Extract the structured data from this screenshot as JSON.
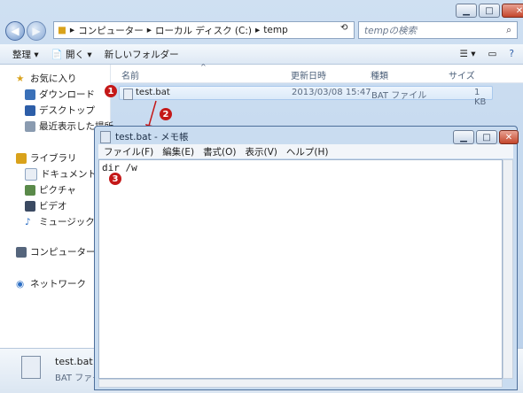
{
  "address": {
    "path": [
      "コンピューター",
      "ローカル ディスク (C:)",
      "temp"
    ]
  },
  "search": {
    "placeholder": "tempの検索"
  },
  "toolbar": {
    "organize": "整理",
    "open": "開く",
    "new_folder": "新しいフォルダー"
  },
  "nav": {
    "favorites": "お気に入り",
    "fav_items": [
      "ダウンロード",
      "デスクトップ",
      "最近表示した場所"
    ],
    "libraries": "ライブラリ",
    "lib_items": [
      "ドキュメント",
      "ピクチャ",
      "ビデオ",
      "ミュージック"
    ],
    "computer": "コンピューター",
    "network": "ネットワーク"
  },
  "columns": {
    "name": "名前",
    "date": "更新日時",
    "type": "種類",
    "size": "サイズ"
  },
  "file": {
    "name": "test.bat",
    "date": "2013/03/08 15:47",
    "type": "BAT ファイル",
    "size": "1 KB"
  },
  "details": {
    "name": "test.bat",
    "type": "BAT ファイ"
  },
  "notepad": {
    "title": "test.bat - メモ帳",
    "menu": [
      "ファイル(F)",
      "編集(E)",
      "書式(O)",
      "表示(V)",
      "ヘルプ(H)"
    ],
    "content": "dir /w"
  },
  "badges": [
    "1",
    "2",
    "3"
  ],
  "colors": {
    "badge": "#c41818",
    "selection": "#dbeaf9"
  }
}
